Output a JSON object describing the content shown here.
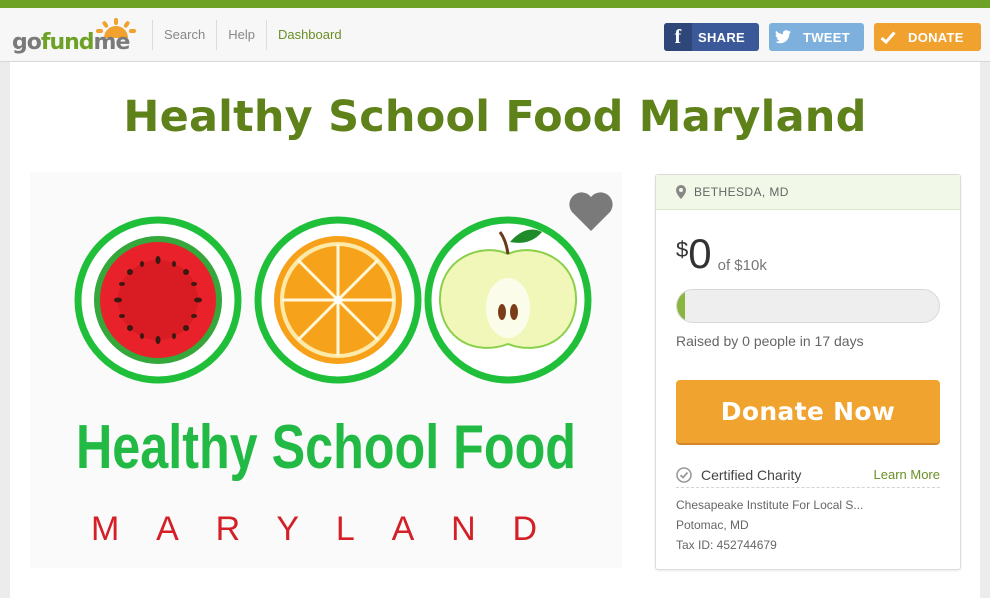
{
  "header": {
    "logo": {
      "part1": "go",
      "part2": "fund",
      "part3": "me"
    },
    "nav": [
      {
        "label": "Search"
      },
      {
        "label": "Help"
      },
      {
        "label": "Dashboard"
      }
    ],
    "share_label": "SHARE",
    "tweet_label": "TWEET",
    "donate_label": "DONATE"
  },
  "campaign": {
    "title": "Healthy School Food Maryland",
    "image_text_line1": "Healthy School Food",
    "image_text_line2": "MARYLAND"
  },
  "sidebar": {
    "location": "BETHESDA, MD",
    "currency": "$",
    "raised": "0",
    "goal": "of $10k",
    "progress": 0.02,
    "raised_text": "Raised by 0 people in 17 days",
    "donate_now": "Donate Now",
    "certified": "Certified Charity",
    "learn_more": "Learn More",
    "org_name": "Chesapeake Institute For Local S...",
    "org_location": "Potomac, MD",
    "tax_id": "Tax ID: 452744679"
  },
  "colors": {
    "brand_green": "#6ea226",
    "title_green": "#5e8119",
    "donate_orange": "#f1a330",
    "facebook": "#3b5998",
    "twitter": "#7eb0dd"
  }
}
